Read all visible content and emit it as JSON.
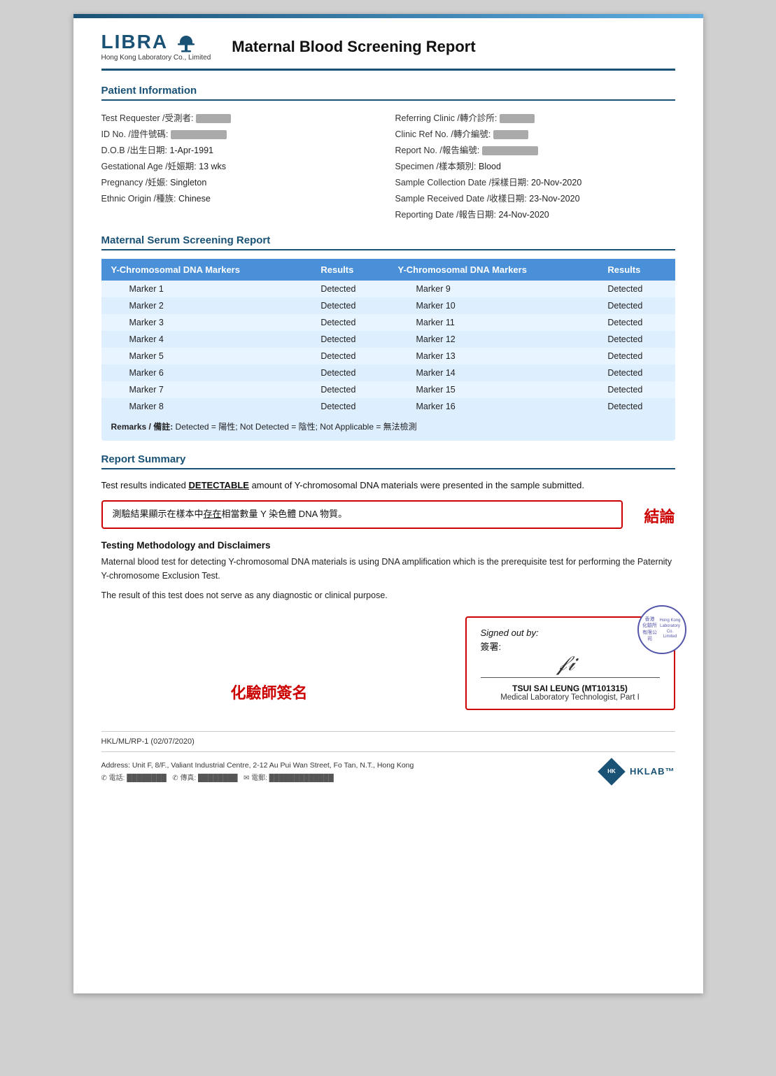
{
  "header": {
    "logo": "LIBRA",
    "company": "Hong Kong Laboratory Co., Limited",
    "title": "Maternal Blood Screening Report"
  },
  "patient_info": {
    "section_title": "Patient Information",
    "left_fields": [
      {
        "label": "Test Requester /受測者:",
        "value": ""
      },
      {
        "label": "ID No. /證件號碼:",
        "value": ""
      },
      {
        "label": "D.O.B /出生日期:",
        "value": "1-Apr-1991"
      },
      {
        "label": "Gestational Age /妊娠期:",
        "value": "13 wks"
      },
      {
        "label": "Pregnancy /妊娠:",
        "value": "Singleton"
      },
      {
        "label": "Ethnic Origin /種族:",
        "value": "Chinese"
      }
    ],
    "right_fields": [
      {
        "label": "Referring Clinic /轉介診所:",
        "value": ""
      },
      {
        "label": "Clinic Ref No. /轉介編號:",
        "value": ""
      },
      {
        "label": "Report No. /報告編號:",
        "value": ""
      },
      {
        "label": "Specimen /樣本類別:",
        "value": "Blood"
      },
      {
        "label": "Sample Collection Date /採樣日期:",
        "value": "20-Nov-2020"
      },
      {
        "label": "Sample Received Date /收樣日期:",
        "value": "23-Nov-2020"
      },
      {
        "label": "Reporting Date /報告日期:",
        "value": "24-Nov-2020"
      }
    ]
  },
  "serum_report": {
    "section_title": "Maternal Serum Screening Report",
    "col1_header": "Y-Chromosomal DNA Markers",
    "col2_header": "Results",
    "col3_header": "Y-Chromosomal DNA Markers",
    "col4_header": "Results",
    "left_markers": [
      {
        "marker": "Marker 1",
        "result": "Detected"
      },
      {
        "marker": "Marker 2",
        "result": "Detected"
      },
      {
        "marker": "Marker 3",
        "result": "Detected"
      },
      {
        "marker": "Marker 4",
        "result": "Detected"
      },
      {
        "marker": "Marker 5",
        "result": "Detected"
      },
      {
        "marker": "Marker 6",
        "result": "Detected"
      },
      {
        "marker": "Marker 7",
        "result": "Detected"
      },
      {
        "marker": "Marker 8",
        "result": "Detected"
      }
    ],
    "right_markers": [
      {
        "marker": "Marker 9",
        "result": "Detected"
      },
      {
        "marker": "Marker 10",
        "result": "Detected"
      },
      {
        "marker": "Marker 11",
        "result": "Detected"
      },
      {
        "marker": "Marker 12",
        "result": "Detected"
      },
      {
        "marker": "Marker 13",
        "result": "Detected"
      },
      {
        "marker": "Marker 14",
        "result": "Detected"
      },
      {
        "marker": "Marker 15",
        "result": "Detected"
      },
      {
        "marker": "Marker 16",
        "result": "Detected"
      }
    ],
    "remarks": "Remarks / 備註: Detected = 陽性; Not Detected = 陰性; Not Applicable = 無法檢測"
  },
  "report_summary": {
    "section_title": "Report Summary",
    "summary_line1": "Test results indicated ",
    "detectable": "DETECTABLE",
    "summary_line2": " amount of Y-chromosomal DNA materials were presented in the sample submitted.",
    "conclusion_zh": "測驗結果顯示在樣本中存在相當數量 Y 染色體 DNA 物質。",
    "conclusion_underline": "存在",
    "conclusion_label": "結論"
  },
  "methodology": {
    "title": "Testing Methodology and Disclaimers",
    "text1": "Maternal blood test for detecting Y-chromosomal DNA materials is using DNA amplification which is the prerequisite test for performing the Paternity Y-chromosome Exclusion Test.",
    "text2": "The result of this test does not serve as any diagnostic or clinical purpose."
  },
  "signature": {
    "chemist_label": "化驗師簽名",
    "signed_out_by": "Signed out by:",
    "signed_out_zh": "簽署:",
    "signer_name": "TSUI SAI LEUNG (MT101315)",
    "signer_title": "Medical Laboratory Technologist, Part I",
    "stamp_text": "香港\n化驗所\n有限公司\nHong Kong\nLaboratory Co.\nLimited"
  },
  "footer": {
    "ref": "HKL/ML/RP-1 (02/07/2020)",
    "address": "Address: Unit F, 8/F., Valiant Industrial Centre, 2-12 Au Pui Wan Street, Fo Tan, N.T., Hong Kong",
    "contacts": "電話: xxxxxxxxxx  傳真: xxxxxxxxxx  電郵: xxxxxxxxxx"
  }
}
